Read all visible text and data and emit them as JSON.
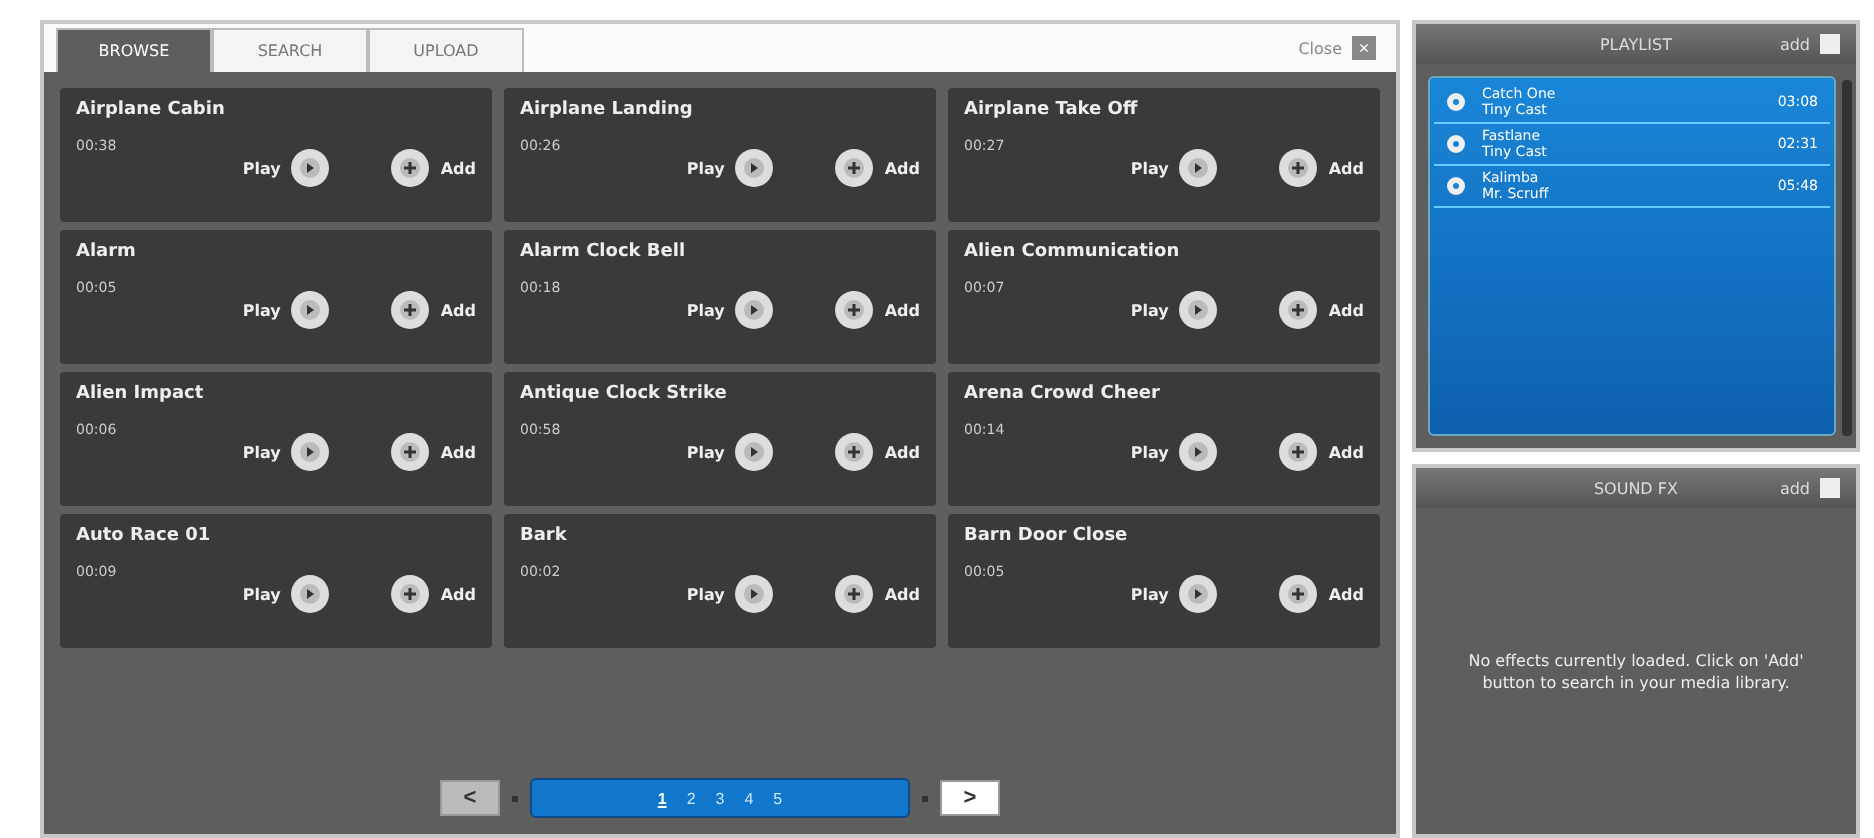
{
  "tabs": [
    {
      "label": "BROWSE",
      "selected": true
    },
    {
      "label": "SEARCH",
      "selected": false
    },
    {
      "label": "UPLOAD",
      "selected": false
    }
  ],
  "close": {
    "label": "Close",
    "icon": "×"
  },
  "sounds": [
    {
      "name": "Airplane Cabin",
      "time": "00:38",
      "play": "Play",
      "add": "Add"
    },
    {
      "name": "Airplane Landing",
      "time": "00:26",
      "play": "Play",
      "add": "Add"
    },
    {
      "name": "Airplane Take Off",
      "time": "00:27",
      "play": "Play",
      "add": "Add"
    },
    {
      "name": "Alarm",
      "time": "00:05",
      "play": "Play",
      "add": "Add"
    },
    {
      "name": "Alarm Clock Bell",
      "time": "00:18",
      "play": "Play",
      "add": "Add"
    },
    {
      "name": "Alien Communication",
      "time": "00:07",
      "play": "Play",
      "add": "Add"
    },
    {
      "name": "Alien Impact",
      "time": "00:06",
      "play": "Play",
      "add": "Add"
    },
    {
      "name": "Antique Clock Strike",
      "time": "00:58",
      "play": "Play",
      "add": "Add"
    },
    {
      "name": "Arena Crowd Cheer",
      "time": "00:14",
      "play": "Play",
      "add": "Add"
    },
    {
      "name": "Auto Race 01",
      "time": "00:09",
      "play": "Play",
      "add": "Add"
    },
    {
      "name": "Bark",
      "time": "00:02",
      "play": "Play",
      "add": "Add"
    },
    {
      "name": "Barn Door Close",
      "time": "00:05",
      "play": "Play",
      "add": "Add"
    }
  ],
  "pagination": {
    "prev": "<",
    "next": ">",
    "pages": [
      {
        "label": "1",
        "selected": true
      },
      {
        "label": "2",
        "selected": false
      },
      {
        "label": "3",
        "selected": false
      },
      {
        "label": "4",
        "selected": false
      },
      {
        "label": "5",
        "selected": false
      }
    ]
  },
  "playlist": {
    "title": "PLAYLIST",
    "add": "add",
    "items": [
      {
        "title": "Catch One",
        "artist": "Tiny Cast",
        "time": "03:08"
      },
      {
        "title": "Fastlane",
        "artist": "Tiny Cast",
        "time": "02:31"
      },
      {
        "title": "Kalimba",
        "artist": "Mr. Scruff",
        "time": "05:48"
      }
    ]
  },
  "sound_fx": {
    "title": "SOUND FX",
    "add": "add",
    "message": "No effects currently loaded. Click on 'Add' button to search in your media library."
  }
}
